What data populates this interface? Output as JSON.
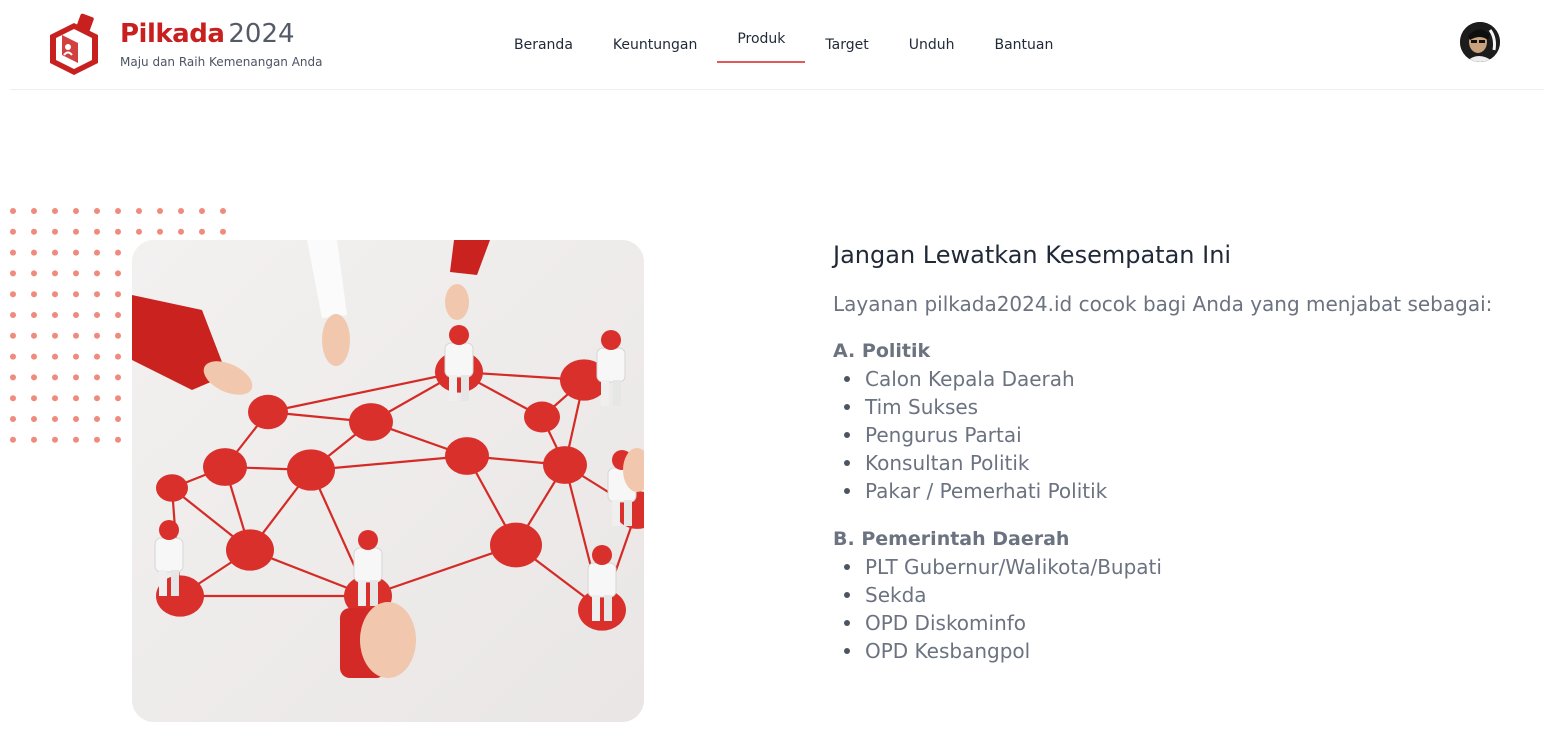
{
  "brand": {
    "name": "Pilkada",
    "year": "2024",
    "tagline": "Maju dan Raih Kemenangan Anda",
    "accent_color": "#c8201f"
  },
  "nav": {
    "items": [
      {
        "label": "Beranda",
        "active": false
      },
      {
        "label": "Keuntungan",
        "active": false
      },
      {
        "label": "Produk",
        "active": true
      },
      {
        "label": "Target",
        "active": false
      },
      {
        "label": "Unduh",
        "active": false
      },
      {
        "label": "Bantuan",
        "active": false
      }
    ],
    "active_color": "#e05a5a"
  },
  "icons": {
    "logo": "ballot-box-logo-icon",
    "avatar": "user-avatar",
    "dots": "dot-pattern",
    "image": "network-people-illustration"
  },
  "main": {
    "heading": "Jangan Lewatkan Kesempatan Ini",
    "intro": "Layanan pilkada2024.id cocok bagi Anda yang menjabat sebagai:",
    "sections": [
      {
        "title": "A. Politik",
        "items": [
          "Calon Kepala Daerah",
          "Tim Sukses",
          "Pengurus Partai",
          "Konsultan Politik",
          "Pakar / Pemerhati Politik"
        ]
      },
      {
        "title": "B. Pemerintah Daerah",
        "items": [
          "PLT Gubernur/Walikota/Bupati",
          "Sekda",
          "OPD Diskominfo",
          "OPD Kesbangpol"
        ]
      }
    ]
  }
}
